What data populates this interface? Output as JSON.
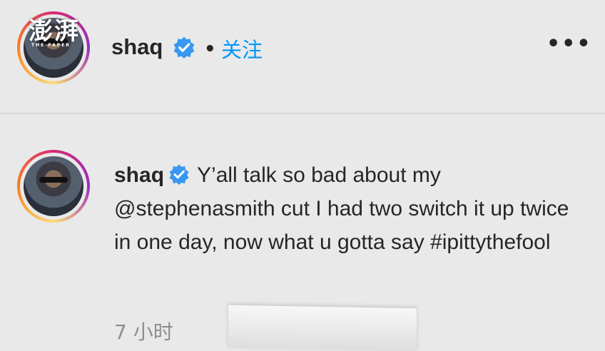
{
  "header": {
    "watermark": "澎湃",
    "watermark_sub": "THE PAPER",
    "username": "shaq",
    "separator": "•",
    "follow_label": "关注",
    "more_label": "•••"
  },
  "post": {
    "username": "shaq",
    "caption": "Y’all talk so bad about my @stephenasmith cut I had two switch it up twice in one day, now what u gotta say #ipittythefool",
    "timestamp": "7 小时"
  },
  "colors": {
    "accent": "#0095f6",
    "background": "#e9e9e9",
    "verified": "#3897f0"
  }
}
